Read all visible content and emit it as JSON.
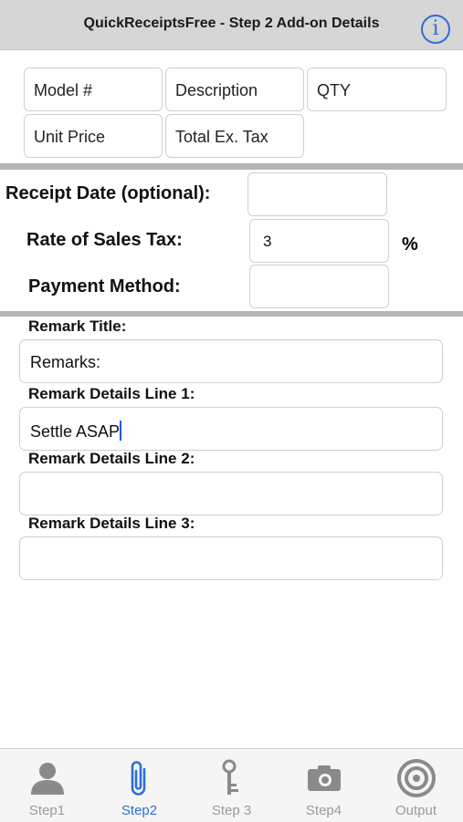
{
  "header": {
    "title": "QuickReceiptsFree - Step 2 Add-on Details",
    "info_icon": "info-icon",
    "info_glyph": "i"
  },
  "columns": {
    "model": "Model #",
    "description": "Description",
    "qty": "QTY",
    "unit_price": "Unit Price",
    "total_ex_tax": "Total Ex. Tax"
  },
  "receipt": {
    "date_label": "Receipt Date (optional):",
    "date_value": "",
    "tax_label": "Rate of Sales Tax:",
    "tax_value": "3",
    "tax_unit": "%",
    "payment_label": "Payment Method:",
    "payment_value": ""
  },
  "remarks": {
    "title_label": "Remark Title:",
    "title_value": "Remarks:",
    "line1_label": "Remark Details Line 1:",
    "line1_value": "Settle ASAP",
    "line2_label": "Remark Details Line 2:",
    "line2_value": "",
    "line3_label": "Remark Details Line 3:",
    "line3_value": ""
  },
  "tabs": [
    {
      "label": "Step1",
      "icon": "person-icon",
      "active": false
    },
    {
      "label": "Step2",
      "icon": "paperclip-icon",
      "active": true
    },
    {
      "label": "Step 3",
      "icon": "key-icon",
      "active": false
    },
    {
      "label": "Step4",
      "icon": "camera-icon",
      "active": false
    },
    {
      "label": "Output",
      "icon": "target-icon",
      "active": false
    }
  ],
  "colors": {
    "accent": "#2f6fd6",
    "inactive": "#9b9b9b",
    "header_bg": "#d6d6d6"
  }
}
